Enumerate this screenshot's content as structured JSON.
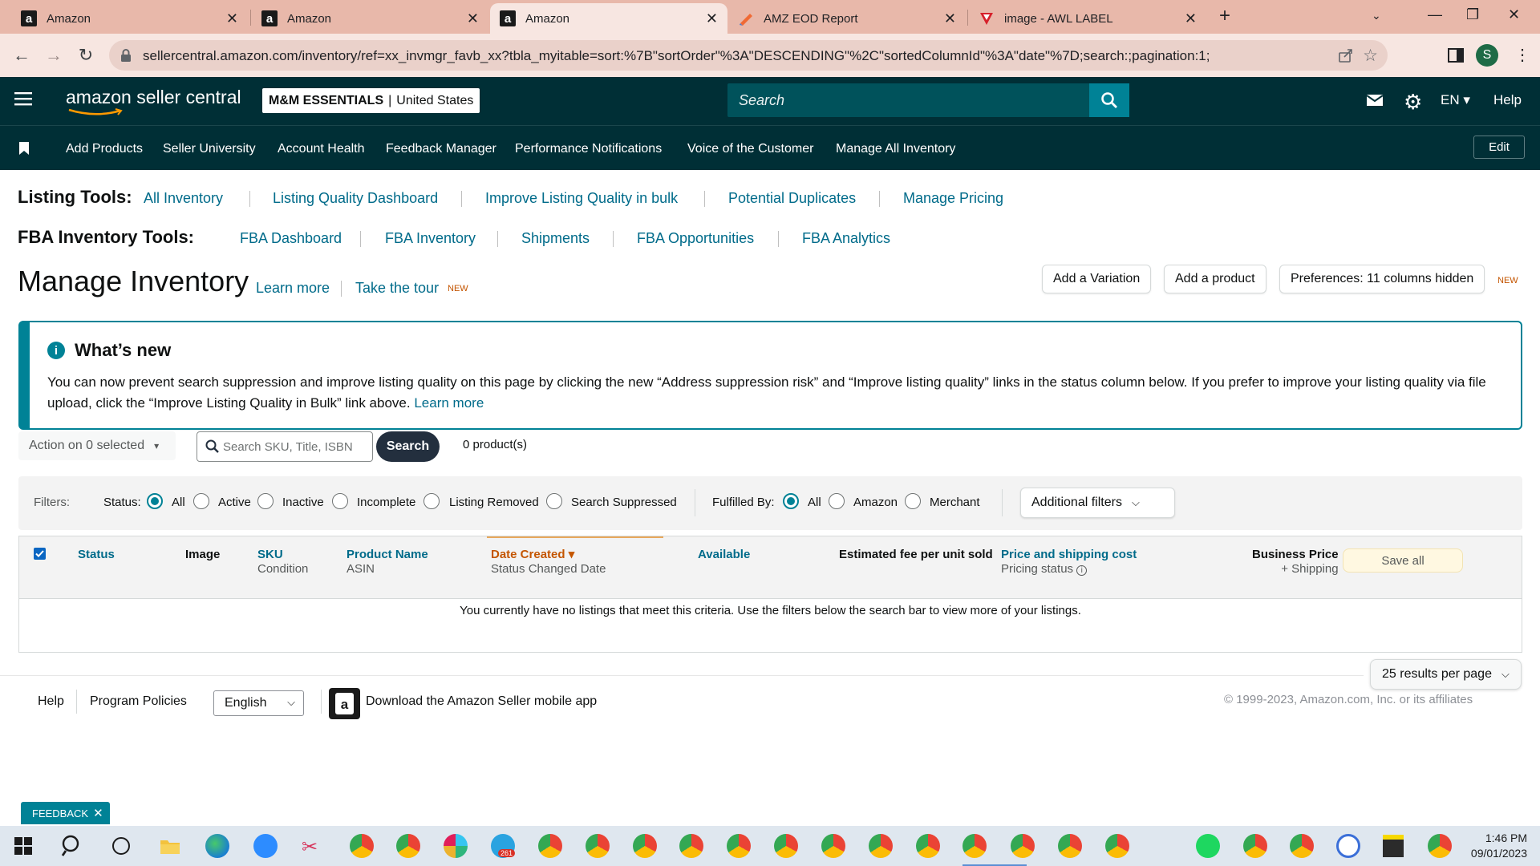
{
  "browser": {
    "tabs": [
      {
        "title": "Amazon",
        "icon": "amazon-favicon"
      },
      {
        "title": "Amazon",
        "icon": "amazon-favicon"
      },
      {
        "title": "Amazon",
        "icon": "amazon-favicon",
        "active": true
      },
      {
        "title": "AMZ EOD Report",
        "icon": "report-favicon"
      },
      {
        "title": "image - AWL LABEL",
        "icon": "awl-favicon"
      }
    ],
    "url": "sellercentral.amazon.com/inventory/ref=xx_invmgr_favb_xx?tbla_myitable=sort:%7B\"sortOrder\"%3A\"DESCENDING\"%2C\"sortedColumnId\"%3A\"date\"%7D;search:;pagination:1;",
    "profile_initial": "S"
  },
  "header": {
    "logo": "amazon seller central",
    "store_name": "M&M ESSENTIALS",
    "store_region": "United States",
    "search_placeholder": "Search",
    "language": "EN",
    "help": "Help"
  },
  "nav": {
    "links": [
      "Add Products",
      "Seller University",
      "Account Health",
      "Feedback Manager",
      "Performance Notifications",
      "Voice of the Customer",
      "Manage All Inventory"
    ],
    "edit": "Edit"
  },
  "listing_tools": {
    "label": "Listing Tools:",
    "links": [
      "All Inventory",
      "Listing Quality Dashboard",
      "Improve Listing Quality in bulk",
      "Potential Duplicates",
      "Manage Pricing"
    ]
  },
  "fba_tools": {
    "label": "FBA Inventory Tools:",
    "links": [
      "FBA Dashboard",
      "FBA Inventory",
      "Shipments",
      "FBA Opportunities",
      "FBA Analytics"
    ]
  },
  "page": {
    "title": "Manage Inventory",
    "learn_more": "Learn more",
    "take_tour": "Take the tour",
    "new_badge": "NEW",
    "add_variation": "Add a Variation",
    "add_product": "Add a product",
    "preferences": "Preferences: 11 columns hidden",
    "preferences_badge": "NEW"
  },
  "notice": {
    "title": "What’s new",
    "body": "You can now prevent search suppression and improve listing quality on this page by clicking the new “Address suppression risk” and “Improve listing quality” links in the status column below. If you prefer to improve your listing quality via file upload, click the “Improve Listing Quality in Bulk” link above.",
    "link": "Learn more"
  },
  "toolbar": {
    "action": "Action on 0 selected",
    "search_placeholder": "Search SKU, Title, ISBN",
    "search_button": "Search",
    "count": "0 product(s)"
  },
  "filters": {
    "label": "Filters:",
    "status_label": "Status:",
    "status_options": [
      "All",
      "Active",
      "Inactive",
      "Incomplete",
      "Listing Removed",
      "Search Suppressed"
    ],
    "status_selected": "All",
    "fulfilled_label": "Fulfilled By:",
    "fulfilled_options": [
      "All",
      "Amazon",
      "Merchant"
    ],
    "fulfilled_selected": "All",
    "additional": "Additional filters"
  },
  "table": {
    "columns": {
      "status": "Status",
      "image": "Image",
      "sku": "SKU",
      "condition": "Condition",
      "product_name": "Product Name",
      "asin": "ASIN",
      "date_created": "Date Created",
      "status_changed": "Status Changed Date",
      "available": "Available",
      "est_fee": "Estimated fee per unit sold",
      "price": "Price and shipping cost",
      "pricing_status": "Pricing status",
      "business_price": "Business Price",
      "plus_shipping": "+ Shipping"
    },
    "save_all": "Save all",
    "empty_message": "You currently have no listings that meet this criteria. Use the filters below the search bar to view more of your listings."
  },
  "pagination": {
    "per_page": "25 results per page"
  },
  "footer": {
    "help": "Help",
    "policies": "Program Policies",
    "language": "English",
    "app": "Download the Amazon Seller mobile app",
    "copyright": "© 1999-2023, Amazon.com, Inc. or its affiliates"
  },
  "feedback": "FEEDBACK",
  "taskbar": {
    "time": "1:46 PM",
    "date": "09/01/2023",
    "badge": "261"
  },
  "colors": {
    "header": "#002f36",
    "accent": "#008296",
    "link": "#006b8a",
    "new": "#c45500"
  }
}
